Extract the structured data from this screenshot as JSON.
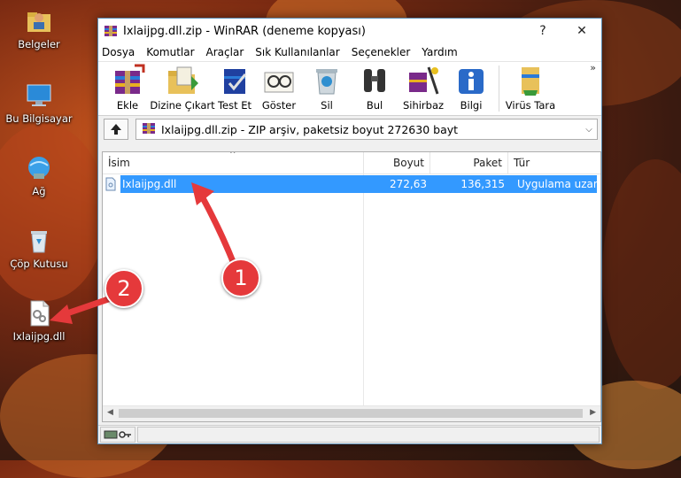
{
  "desktop": {
    "icons": [
      {
        "label": "Belgeler",
        "icon": "folder-user-icon"
      },
      {
        "label": "Bu Bilgisayar",
        "icon": "computer-icon"
      },
      {
        "label": "Ağ",
        "icon": "network-icon"
      },
      {
        "label": "Çöp Kutusu",
        "icon": "recycle-bin-icon"
      },
      {
        "label": "Ixlaijpg.dll",
        "icon": "dll-file-icon"
      }
    ]
  },
  "window": {
    "title": "Ixlaijpg.dll.zip - WinRAR (deneme kopyası)",
    "help": "?",
    "close": "✕",
    "menu": [
      "Dosya",
      "Komutlar",
      "Araçlar",
      "Sık Kullanılanlar",
      "Seçenekler",
      "Yardım"
    ],
    "toolbar": [
      "Ekle",
      "Dizine Çıkart",
      "Test Et",
      "Göster",
      "Sil",
      "Bul",
      "Sihirbaz",
      "Bilgi",
      "Virüs Tara"
    ],
    "toolbar_more": "»",
    "path": "Ixlaijpg.dll.zip - ZIP arşiv, paketsiz boyut 272630 bayt",
    "columns": [
      "İsim",
      "Boyut",
      "Paket",
      "Tür"
    ],
    "files": [
      {
        "name": "Ixlaijpg.dll",
        "size": "272,63",
        "packed": "136,315",
        "type": "Uygulama uzantı"
      }
    ]
  },
  "annotations": {
    "step1": "1",
    "step2": "2"
  },
  "colors": {
    "selection": "#3399ff",
    "badge": "#e5393b"
  }
}
